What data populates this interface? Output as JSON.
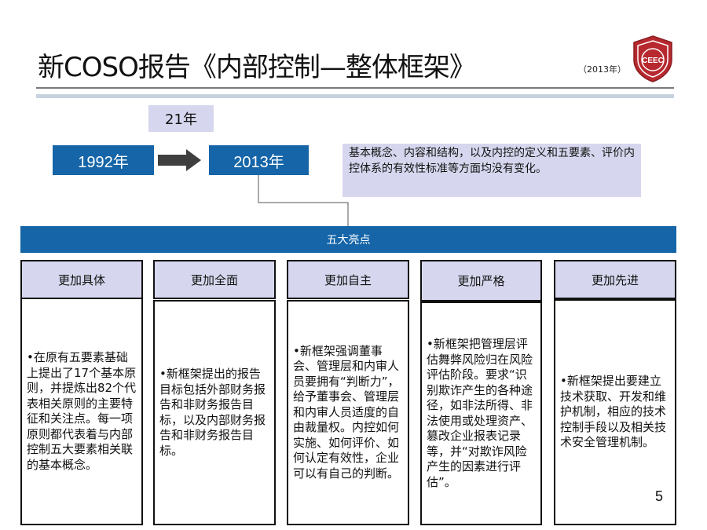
{
  "title": "新COSO报告《内部控制—整体框架》",
  "title_year": "（2013年）",
  "logo_text": "CEEC",
  "timeline": {
    "span_label": "21年",
    "start_year": "1992年",
    "end_year": "2013年",
    "summary": "基本概念、内容和结构，以及内控的定义和五要素、评价内控体系的有效性标准等方面均没有变化。"
  },
  "banner": "五大亮点",
  "cards": [
    {
      "heading": "更加具体",
      "body": "•在原有五要素基础上提出了17个基本原则，并提炼出82个代表相关原则的主要特征和关注点。每一项原则都代表着与内部控制五大要素相关联的基本概念。"
    },
    {
      "heading": "更加全面",
      "body": "•新框架提出的报告目标包括外部财务报告和非财务报告目标，以及内部财务报告和非财务报告目标。"
    },
    {
      "heading": "更加自主",
      "body": "•新框架强调董事会、管理层和内审人员要拥有“判断力”，给予董事会、管理层和内审人员适度的自由裁量权。内控如何实施、如何评价、如何认定有效性，企业可以有自己的判断。"
    },
    {
      "heading": "更加严格",
      "body": "•新框架把管理层评估舞弊风险归在风险评估阶段。要求“识别欺诈产生的各种途径，如非法所得、非法使用或处理资产、篡改企业报表记录等，并“对欺诈风险产生的因素进行评估”。"
    },
    {
      "heading": "更加先进",
      "body": "•新框架提出要建立技术获取、开发和维护机制，相应的技术控制手段以及相关技术安全管理机制。"
    }
  ],
  "page_number": "5",
  "colors": {
    "accent_blue": "#1565a8",
    "lavender": "#d6d7ee",
    "logo_red": "#b7292f"
  }
}
